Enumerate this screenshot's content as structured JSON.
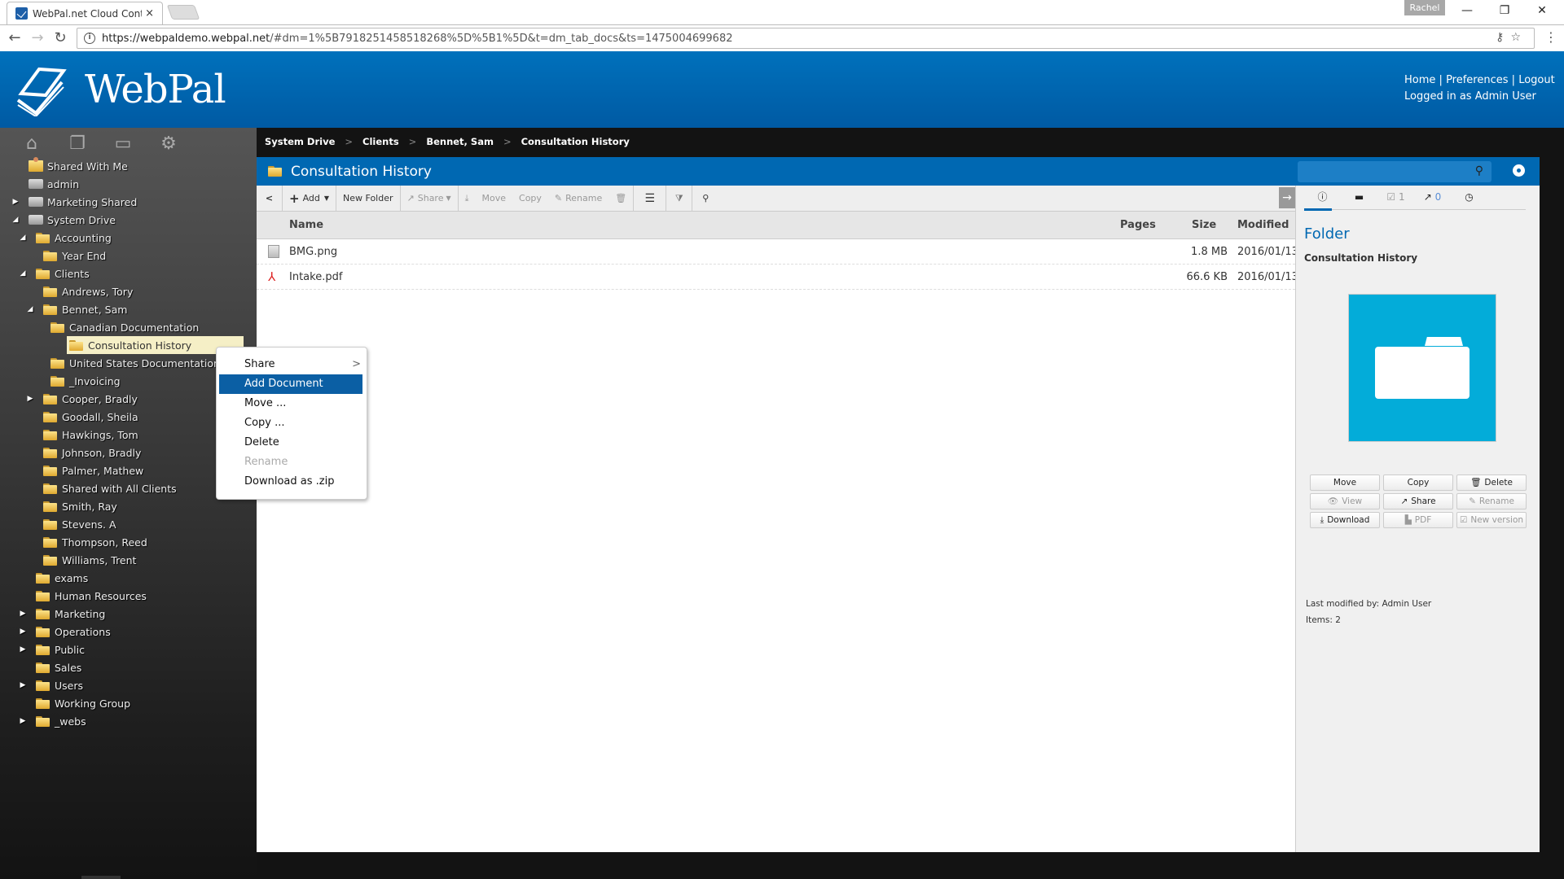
{
  "browser": {
    "tab_title": "WebPal.net Cloud Conte",
    "tab_close": "×",
    "profile": "Rachel",
    "url_host": "https://webpaldemo.webpal.net",
    "url_rest": "/#dm=1%5B7918251458518268%5D%5B1%5D&t=dm_tab_docs&ts=1475004699682",
    "window": {
      "minimize": "—",
      "restore": "❐",
      "close": "✕"
    }
  },
  "header": {
    "logo_text": "WebPal",
    "links": [
      "Home",
      "Preferences",
      "Logout"
    ],
    "separator": "|",
    "logged_in": "Logged in as Admin User"
  },
  "sidebar": {
    "icons": [
      "home-icon",
      "documents-icon",
      "monitor-icon",
      "gear-icon"
    ],
    "tree": [
      {
        "label": "Shared With Me",
        "depth": 0,
        "icon": "shared",
        "arrow": ""
      },
      {
        "label": "admin",
        "depth": 0,
        "icon": "drive",
        "arrow": ""
      },
      {
        "label": "Marketing Shared",
        "depth": 0,
        "icon": "drive",
        "arrow": "▶"
      },
      {
        "label": "System Drive",
        "depth": 0,
        "icon": "drive",
        "arrow": "◢"
      },
      {
        "label": "Accounting",
        "depth": 1,
        "icon": "folder",
        "arrow": "◢"
      },
      {
        "label": "Year End",
        "depth": 2,
        "icon": "folder",
        "arrow": ""
      },
      {
        "label": "Clients",
        "depth": 1,
        "icon": "folder",
        "arrow": "◢"
      },
      {
        "label": "Andrews, Tory",
        "depth": 2,
        "icon": "folder",
        "arrow": ""
      },
      {
        "label": "Bennet, Sam",
        "depth": 2,
        "icon": "folder",
        "arrow": "◢"
      },
      {
        "label": "Canadian Documentation",
        "depth": 3,
        "icon": "folder",
        "arrow": ""
      },
      {
        "label": "Consultation History",
        "depth": 3,
        "icon": "folder",
        "arrow": "",
        "selected": true
      },
      {
        "label": "United States Documentation",
        "depth": 3,
        "icon": "folder",
        "arrow": ""
      },
      {
        "label": "_Invoicing",
        "depth": 3,
        "icon": "folder",
        "arrow": ""
      },
      {
        "label": "Cooper, Bradly",
        "depth": 2,
        "icon": "folder",
        "arrow": "▶"
      },
      {
        "label": "Goodall, Sheila",
        "depth": 2,
        "icon": "folder",
        "arrow": ""
      },
      {
        "label": "Hawkings, Tom",
        "depth": 2,
        "icon": "folder",
        "arrow": ""
      },
      {
        "label": "Johnson, Bradly",
        "depth": 2,
        "icon": "folder",
        "arrow": ""
      },
      {
        "label": "Palmer, Mathew",
        "depth": 2,
        "icon": "folder",
        "arrow": ""
      },
      {
        "label": "Shared with All Clients",
        "depth": 2,
        "icon": "folder",
        "arrow": ""
      },
      {
        "label": "Smith, Ray",
        "depth": 2,
        "icon": "folder",
        "arrow": ""
      },
      {
        "label": "Stevens. A",
        "depth": 2,
        "icon": "folder",
        "arrow": ""
      },
      {
        "label": "Thompson, Reed",
        "depth": 2,
        "icon": "folder",
        "arrow": ""
      },
      {
        "label": "Williams, Trent",
        "depth": 2,
        "icon": "folder",
        "arrow": ""
      },
      {
        "label": "exams",
        "depth": 1,
        "icon": "folder",
        "arrow": ""
      },
      {
        "label": "Human Resources",
        "depth": 1,
        "icon": "folder",
        "arrow": ""
      },
      {
        "label": "Marketing",
        "depth": 1,
        "icon": "folder",
        "arrow": "▶"
      },
      {
        "label": "Operations",
        "depth": 1,
        "icon": "folder",
        "arrow": "▶"
      },
      {
        "label": "Public",
        "depth": 1,
        "icon": "folder",
        "arrow": "▶"
      },
      {
        "label": "Sales",
        "depth": 1,
        "icon": "folder",
        "arrow": ""
      },
      {
        "label": "Users",
        "depth": 1,
        "icon": "folder",
        "arrow": "▶"
      },
      {
        "label": "Working Group",
        "depth": 1,
        "icon": "folder",
        "arrow": ""
      },
      {
        "label": "_webs",
        "depth": 1,
        "icon": "folder",
        "arrow": "▶"
      }
    ]
  },
  "breadcrumb": [
    "System Drive",
    "Clients",
    "Bennet, Sam",
    "Consultation History"
  ],
  "breadcrumb_sep": ">",
  "main": {
    "title": "Consultation History",
    "toolbar": {
      "back": "<",
      "add": "Add",
      "new_folder": "New Folder",
      "share": "Share",
      "move": "Move",
      "copy": "Copy",
      "rename": "Rename"
    },
    "collapse": "→",
    "columns": {
      "name": "Name",
      "pages": "Pages",
      "size": "Size",
      "modified": "Modified"
    },
    "files": [
      {
        "name": "BMG.png",
        "pages": "",
        "size": "1.8 MB",
        "modified": "2016/01/13",
        "type": "image"
      },
      {
        "name": "Intake.pdf",
        "pages": "",
        "size": "66.6 KB",
        "modified": "2016/01/13",
        "type": "pdf"
      }
    ]
  },
  "right_panel": {
    "tabs": {
      "tasks_count": "1",
      "shares_count": "0"
    },
    "type_title": "Folder",
    "item_name": "Consultation History",
    "actions": [
      {
        "label": "Move",
        "icon": "",
        "enabled": true
      },
      {
        "label": "Copy",
        "icon": "",
        "enabled": true
      },
      {
        "label": "Delete",
        "icon": "🗑",
        "enabled": true
      },
      {
        "label": "View",
        "icon": "👁",
        "enabled": false
      },
      {
        "label": "Share",
        "icon": "↗",
        "enabled": true
      },
      {
        "label": "Rename",
        "icon": "✎",
        "enabled": false
      },
      {
        "label": "Download",
        "icon": "⤓",
        "enabled": true
      },
      {
        "label": "PDF",
        "icon": "▙",
        "enabled": false
      },
      {
        "label": "New version",
        "icon": "☑",
        "enabled": false
      }
    ],
    "last_modified": "Last modified by: Admin User",
    "items": "Items: 2"
  },
  "context_menu": {
    "items": [
      {
        "label": "Share",
        "submenu": ">",
        "state": "normal"
      },
      {
        "label": "Add Document",
        "submenu": "",
        "state": "highlighted"
      },
      {
        "label": "Move ...",
        "submenu": "",
        "state": "normal"
      },
      {
        "label": "Copy ...",
        "submenu": "",
        "state": "normal"
      },
      {
        "label": "Delete",
        "submenu": "",
        "state": "normal"
      },
      {
        "label": "Rename",
        "submenu": "",
        "state": "disabled"
      },
      {
        "label": "Download as .zip",
        "submenu": "",
        "state": "normal"
      }
    ]
  },
  "colors": {
    "brand_blue": "#0068b2",
    "preview_bg": "#03acd9",
    "selected_node": "#f5efc6",
    "menu_highlight": "#0b5fa4"
  }
}
